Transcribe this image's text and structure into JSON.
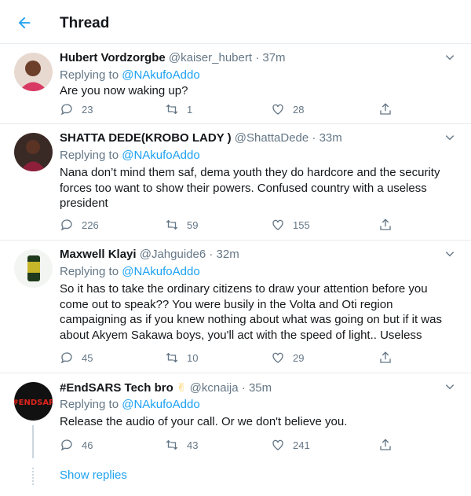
{
  "header": {
    "title": "Thread",
    "back_icon": "arrow-left-icon"
  },
  "colors": {
    "accent": "#1da1f2",
    "muted": "#657786",
    "text": "#14171a",
    "border": "#e6ecf0"
  },
  "tweets": [
    {
      "name": "Hubert Vordzorgbe",
      "handle": "@kaiser_hubert",
      "dot": "·",
      "time": "37m",
      "replying_prefix": "Replying to",
      "replying_to": "@NAkufoAddo",
      "text": "Are you now waking up?",
      "replies": "23",
      "retweets": "1",
      "likes": "28"
    },
    {
      "name": "SHATTA DEDE(KROBO LADY )",
      "handle": "@ShattaDede",
      "dot": "·",
      "time": "33m",
      "replying_prefix": "Replying to",
      "replying_to": "@NAkufoAddo",
      "text": "Nana don’t mind them saf, dema youth they do hardcore and the security forces too want to show their powers. Confused country with a useless president",
      "replies": "226",
      "retweets": "59",
      "likes": "155"
    },
    {
      "name": "Maxwell Klayi",
      "handle": "@Jahguide6",
      "dot": "·",
      "time": "32m",
      "replying_prefix": "Replying to",
      "replying_to": "@NAkufoAddo",
      "text": "So it has to take the ordinary citizens to draw your attention before you come out to speak?? You were busily in the Volta and Oti region campaigning as if you knew nothing about what was going on but if it was about Akyem Sakawa boys, you'll act with the speed of light.. Useless",
      "replies": "45",
      "retweets": "10",
      "likes": "29"
    },
    {
      "name": "#EndSARS Tech bro",
      "emoji": "✌",
      "handle": "@kcnaija",
      "dot": "·",
      "time": "35m",
      "replying_prefix": "Replying to",
      "replying_to": "@NAkufoAddo",
      "text": "Release the audio of your call. Or we don't believe you.",
      "replies": "46",
      "retweets": "43",
      "likes": "241",
      "avatar_text": "#ENDSAR"
    }
  ],
  "show_replies": "Show replies"
}
